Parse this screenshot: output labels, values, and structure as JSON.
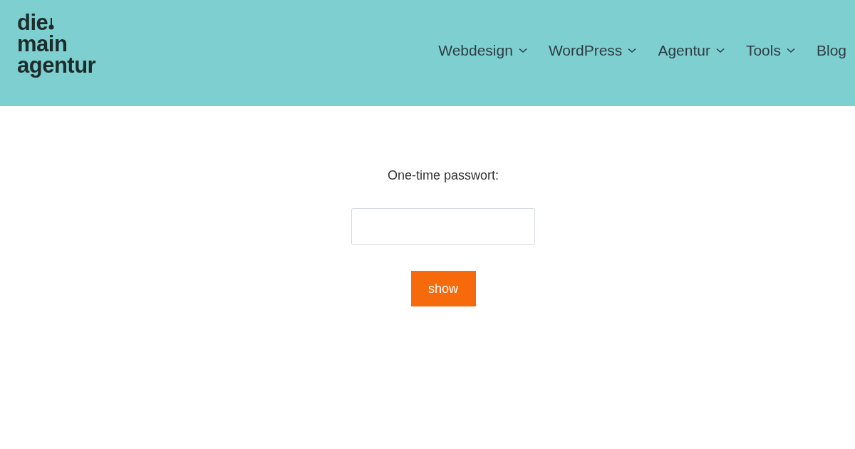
{
  "logo": {
    "lines": [
      "die",
      "main",
      "agentur"
    ]
  },
  "nav": [
    {
      "label": "Webdesign",
      "dropdown": true
    },
    {
      "label": "WordPress",
      "dropdown": true
    },
    {
      "label": "Agentur",
      "dropdown": true
    },
    {
      "label": "Tools",
      "dropdown": true
    },
    {
      "label": "Blog",
      "dropdown": false
    }
  ],
  "form": {
    "label": "One-time passwort:",
    "button": "show"
  }
}
